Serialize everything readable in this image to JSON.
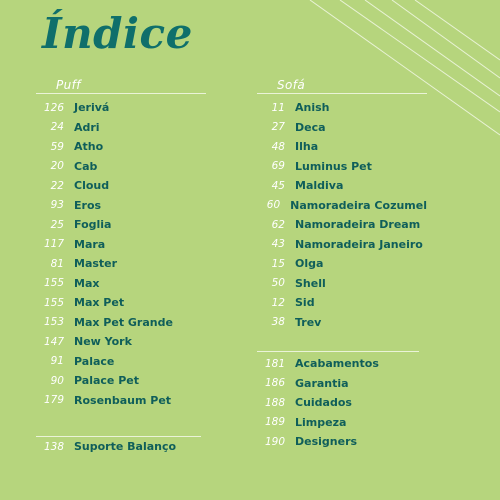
{
  "title": "Índice",
  "left": {
    "heading": "Puff",
    "items": [
      {
        "num": "126",
        "name": "Jerivá"
      },
      {
        "num": "24",
        "name": "Adri"
      },
      {
        "num": "59",
        "name": "Atho"
      },
      {
        "num": "20",
        "name": "Cab"
      },
      {
        "num": "22",
        "name": "Cloud"
      },
      {
        "num": "93",
        "name": "Eros"
      },
      {
        "num": "25",
        "name": "Foglia"
      },
      {
        "num": "117",
        "name": "Mara"
      },
      {
        "num": "81",
        "name": "Master"
      },
      {
        "num": "155",
        "name": "Max"
      },
      {
        "num": "155",
        "name": "Max Pet"
      },
      {
        "num": "153",
        "name": "Max Pet Grande"
      },
      {
        "num": "147",
        "name": "New York"
      },
      {
        "num": "91",
        "name": "Palace"
      },
      {
        "num": "90",
        "name": "Palace Pet"
      },
      {
        "num": "179",
        "name": "Rosenbaum Pet"
      }
    ],
    "extra": [
      {
        "num": "138",
        "name": "Suporte Balanço"
      }
    ]
  },
  "right": {
    "heading": "Sofá",
    "items": [
      {
        "num": "11",
        "name": "Anish"
      },
      {
        "num": "27",
        "name": "Deca"
      },
      {
        "num": "48",
        "name": "Ilha"
      },
      {
        "num": "69",
        "name": "Luminus Pet"
      },
      {
        "num": "45",
        "name": "Maldiva"
      },
      {
        "num": "60",
        "name": "Namoradeira Cozumel"
      },
      {
        "num": "62",
        "name": "Namoradeira Dream"
      },
      {
        "num": "43",
        "name": "Namoradeira Janeiro"
      },
      {
        "num": "15",
        "name": "Olga"
      },
      {
        "num": "50",
        "name": "Shell"
      },
      {
        "num": "12",
        "name": "Sid"
      },
      {
        "num": "38",
        "name": "Trev"
      }
    ],
    "extra": [
      {
        "num": "181",
        "name": "Acabamentos"
      },
      {
        "num": "186",
        "name": "Garantia"
      },
      {
        "num": "188",
        "name": "Cuidados"
      },
      {
        "num": "189",
        "name": "Limpeza"
      },
      {
        "num": "190",
        "name": "Designers"
      }
    ]
  },
  "colors": {
    "background": "#b6d57d",
    "title": "#0f6f6b",
    "entry_text": "#0f5e5a",
    "numbers": "#ffffff"
  }
}
